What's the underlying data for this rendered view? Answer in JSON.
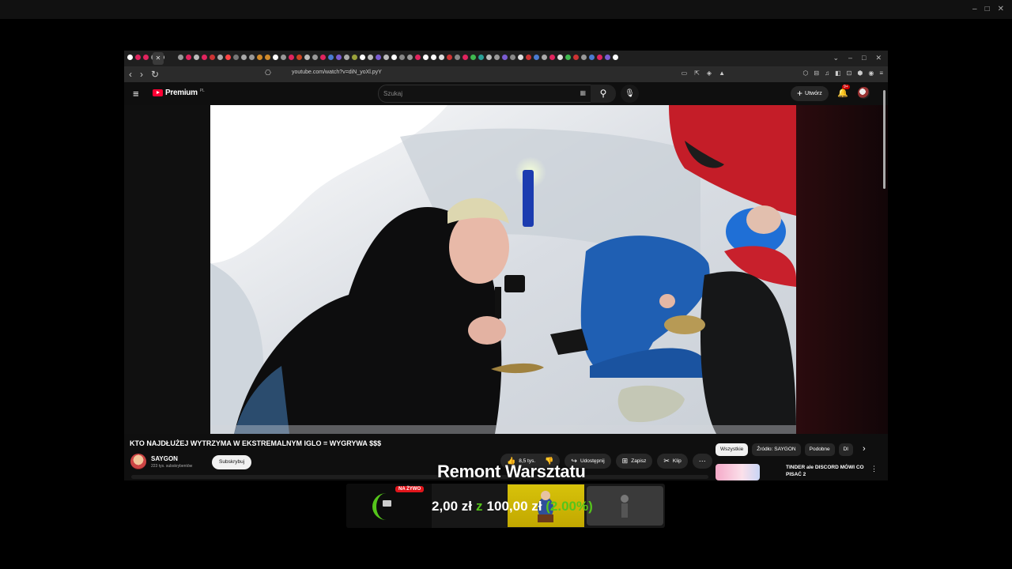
{
  "window": {
    "controls": [
      "–",
      "□",
      "✕"
    ]
  },
  "browser": {
    "tab_colors": [
      "#ffffff",
      "#e0245e",
      "#e0245e",
      "#888888",
      "#cccccc",
      "#999999",
      "#e0245e",
      "#bbbbbb",
      "#e0245e",
      "#cc3333",
      "#aaaaaa",
      "#ff4444",
      "#777777",
      "#aaaaaa",
      "#999999",
      "#d08a2a",
      "#d08a2a",
      "#ffffff",
      "#999999",
      "#e0245e",
      "#cc4422",
      "#bbbbbb",
      "#999999",
      "#e0245e",
      "#4a7bd1",
      "#7a5cd1",
      "#aaaaaa",
      "#9aa13a",
      "#ffffff",
      "#bbbbbb",
      "#7a5cd1",
      "#bbbbbb",
      "#ffffff",
      "#888888",
      "#999999",
      "#e0245e",
      "#ffffff",
      "#ffffff",
      "#dddddd",
      "#cc3333",
      "#888888",
      "#e0245e",
      "#3fb950",
      "#2aa198",
      "#bbbbbb",
      "#999999",
      "#7a5cd1",
      "#888888",
      "#dddddd",
      "#cc3333",
      "#4a7bd1",
      "#aaaaaa",
      "#e0245e",
      "#dddddd",
      "#3fb950",
      "#cc3333",
      "#999999",
      "#4a7bd1",
      "#e0245e",
      "#7a5cd1",
      "#ffffff"
    ],
    "active_tab_label": "✕",
    "tabstrip_controls": [
      "⌄",
      "–",
      "□",
      "✕"
    ],
    "nav": {
      "back": "‹",
      "forward": "›",
      "reload": "↻"
    },
    "url": "youtube.com/watch?v=diN_yoXl.pyY",
    "bookmark_icon": "⎔",
    "url_actions": [
      "▭",
      "⇱",
      "◈",
      "▲"
    ],
    "extensions": [
      "⬡",
      "⊟",
      "♫",
      "◧",
      "⊡",
      "⬢",
      "◉",
      "≡"
    ]
  },
  "youtube": {
    "menu_icon": "≡",
    "logo_text": "Premium",
    "logo_suffix": "PL",
    "search_placeholder": "Szukaj",
    "keyboard_icon": "▦",
    "search_icon": "⚲",
    "mic_icon": "🎙",
    "create_label": "Utwórz",
    "create_icon": "+",
    "bell_icon": "🔔",
    "bell_badge": "9+",
    "video": {
      "title": "KTO NAJDŁUŻEJ WYTRZYMA W EKSTREMALNYM IGLO = WYGRYWA $$$",
      "channel": "SAYGON",
      "subscribers": "223 tys. subskrybentów",
      "subscribe_label": "Subskrybuj",
      "likes": "8,5 tys.",
      "like_icon": "👍",
      "dislike_icon": "👎",
      "share_label": "Udostępnij",
      "share_icon": "↪",
      "save_label": "Zapisz",
      "save_icon": "⊞",
      "clip_label": "Klip",
      "clip_icon": "✂",
      "more_icon": "⋯"
    },
    "chips": [
      "Wszystkie",
      "Źródło: SAYGON",
      "Podobne",
      "Dl"
    ],
    "chips_next": "›",
    "recommendation": {
      "title": "TINDER ale DISCORD MÓWI CO PISAĆ 2",
      "more_icon": "⋮"
    }
  },
  "stream_overlay": {
    "title": "Remont Warsztatu",
    "live_badge": "NA ŻYWO",
    "current": "2,00 zł",
    "separator": "z",
    "goal": "100,00 zł",
    "percent_label": "(2.00%)",
    "progress_fraction": 0.02,
    "accent": "#55c51b"
  }
}
